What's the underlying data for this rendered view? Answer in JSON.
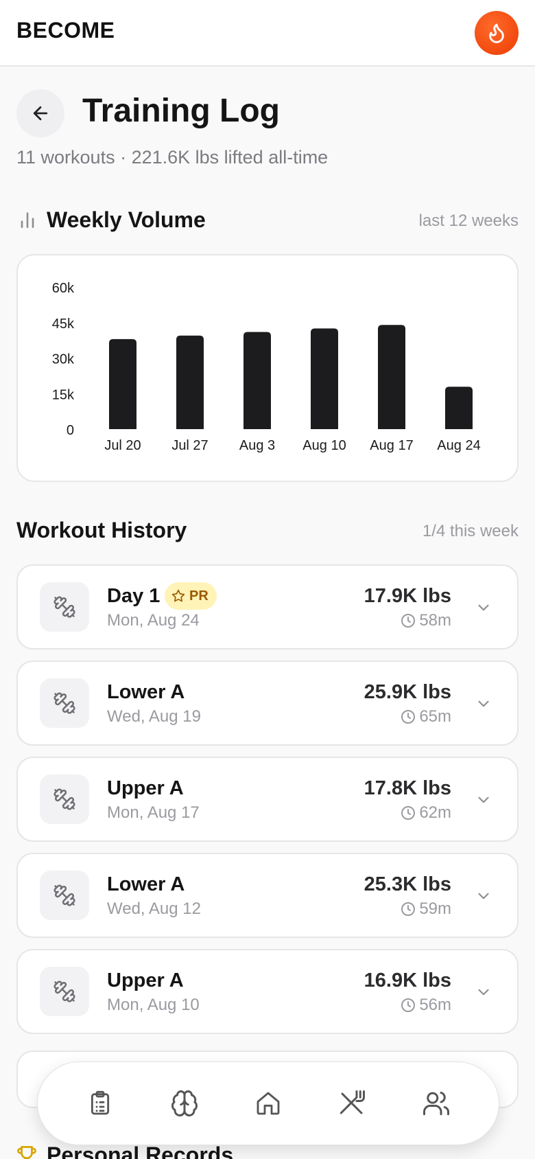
{
  "app": {
    "brand": "BECOME"
  },
  "header": {
    "title": "Training Log",
    "subtitle": "11 workouts · 221.6K lbs lifted all-time"
  },
  "weekly_volume": {
    "title": "Weekly Volume",
    "range_label": "last 12 weeks"
  },
  "chart_data": {
    "type": "bar",
    "title": "Weekly Volume",
    "categories": [
      "Jul 20",
      "Jul 27",
      "Aug 3",
      "Aug 10",
      "Aug 17",
      "Aug 24"
    ],
    "values": [
      38000,
      39500,
      41000,
      42500,
      44000,
      17900
    ],
    "yticks": [
      0,
      15000,
      30000,
      45000,
      60000
    ],
    "ytick_labels": [
      "0",
      "15k",
      "30k",
      "45k",
      "60k"
    ],
    "ylim": [
      0,
      60000
    ],
    "grid": false,
    "bar_color": "#1c1c1e"
  },
  "history": {
    "title": "Workout History",
    "week_progress": "1/4 this week",
    "workouts": [
      {
        "name": "Day 1",
        "date": "Mon, Aug 24",
        "volume": "17.9K lbs",
        "duration": "58m",
        "pr": "PR"
      },
      {
        "name": "Lower A",
        "date": "Wed, Aug 19",
        "volume": "25.9K lbs",
        "duration": "65m"
      },
      {
        "name": "Upper A",
        "date": "Mon, Aug 17",
        "volume": "17.8K lbs",
        "duration": "62m"
      },
      {
        "name": "Lower A",
        "date": "Wed, Aug 12",
        "volume": "25.3K lbs",
        "duration": "59m"
      },
      {
        "name": "Upper A",
        "date": "Mon, Aug 10",
        "volume": "16.9K lbs",
        "duration": "56m"
      }
    ]
  },
  "records": {
    "title": "Personal Records"
  },
  "nav": {
    "items": [
      "clipboard-icon",
      "brain-icon",
      "home-icon",
      "nutrition-icon",
      "community-icon"
    ]
  },
  "colors": {
    "accent": "#f24a0f",
    "pr_badge_bg": "#fff3b8",
    "pr_badge_text": "#9a5a00",
    "trophy": "#d9a400"
  }
}
